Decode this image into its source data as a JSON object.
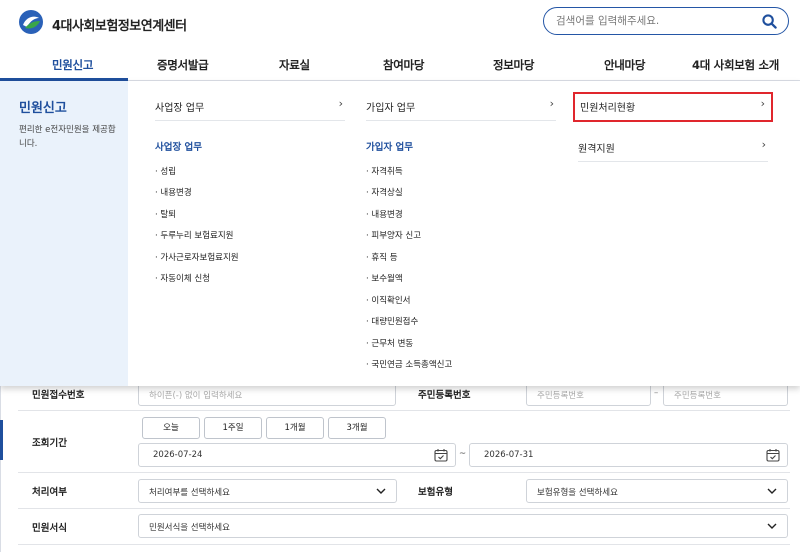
{
  "header": {
    "logo_text": "4대사회보험정보연계센터",
    "search_placeholder": "검색어를 입력해주세요."
  },
  "nav": {
    "items": [
      "민원신고",
      "증명서발급",
      "자료실",
      "참여마당",
      "정보마당",
      "안내마당",
      "4대 사회보험 소개"
    ],
    "active_index": 0
  },
  "mega_menu": {
    "title": "민원신고",
    "description": "편리한 e전자민원을 제공합니다.",
    "col1": {
      "head": "사업장 업무",
      "sub_title": "사업장 업무",
      "items": [
        "· 성립",
        "· 내용변경",
        "· 탈퇴",
        "· 두루누리 보험료지원",
        "· 가사근로자보험료지원",
        "· 자동이체 신청"
      ]
    },
    "col2": {
      "head": "가입자 업무",
      "sub_title": "가입자 업무",
      "items": [
        "· 자격취득",
        "· 자격상실",
        "· 내용변경",
        "· 피부양자 신고",
        "· 휴직 등",
        "· 보수월액",
        "· 이직확인서",
        "· 대량민원접수",
        "· 근무처 변동",
        "· 국민연금 소득총액신고"
      ]
    },
    "col3": {
      "head_highlighted": "민원처리현황",
      "head2": "원격지원"
    },
    "chevron": "›"
  },
  "form": {
    "row1": {
      "label": "민원접수번호",
      "input_placeholder": "하이픈(-) 없이 입력하세요",
      "label2": "주민등록번호",
      "rrn_placeholder1": "주민등록번호",
      "dash": "–",
      "rrn_placeholder2": "주민등록번호"
    },
    "row2": {
      "label": "조회기간",
      "buttons": [
        "오늘",
        "1주일",
        "1개월",
        "3개월"
      ],
      "date_from": "2026-07-24",
      "tilde": "~",
      "date_to": "2026-07-31"
    },
    "row3": {
      "label": "처리여부",
      "select1": "처리여부를 선택하세요",
      "label2": "보험유형",
      "select2": "보험유형을 선택하세요"
    },
    "row4": {
      "label": "민원서식",
      "select": "민원서식을 선택하세요"
    }
  }
}
